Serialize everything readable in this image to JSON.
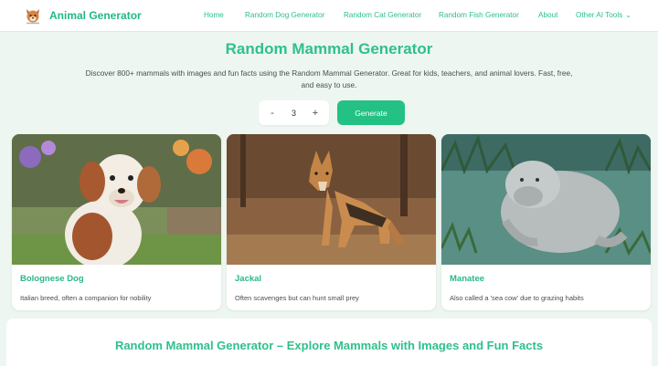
{
  "brand": {
    "name": "Animal Generator",
    "logo": "animal-face-logo"
  },
  "nav": {
    "links": [
      {
        "label": "Home"
      },
      {
        "label": "Random Dog Generator"
      },
      {
        "label": "Random Cat Generator"
      },
      {
        "label": "Random Fish Generator"
      },
      {
        "label": "About"
      },
      {
        "label": "Other AI Tools",
        "icon": "chevron-down-icon"
      }
    ]
  },
  "hero": {
    "title": "Random Mammal Generator",
    "description": "Discover 800+ mammals with images and fun facts using the Random Mammal Generator. Great for kids, teachers, and animal lovers. Fast, free, and easy to use."
  },
  "controls": {
    "minus": "-",
    "count": "3",
    "plus": "+",
    "generate_label": "Generate"
  },
  "cards": [
    {
      "name": "Bolognese Dog",
      "fact": "Italian breed, often a companion for nobility",
      "image": "fluffy-dog-photo"
    },
    {
      "name": "Jackal",
      "fact": "Often scavenges but can hunt small prey",
      "image": "jackal-photo"
    },
    {
      "name": "Manatee",
      "fact": "Also called a 'sea cow' due to grazing habits",
      "image": "manatee-photo"
    }
  ],
  "section": {
    "title": "Random Mammal Generator – Explore Mammals with Images and Fun Facts"
  },
  "colors": {
    "accent": "#23c183",
    "background": "#eef6f1"
  }
}
